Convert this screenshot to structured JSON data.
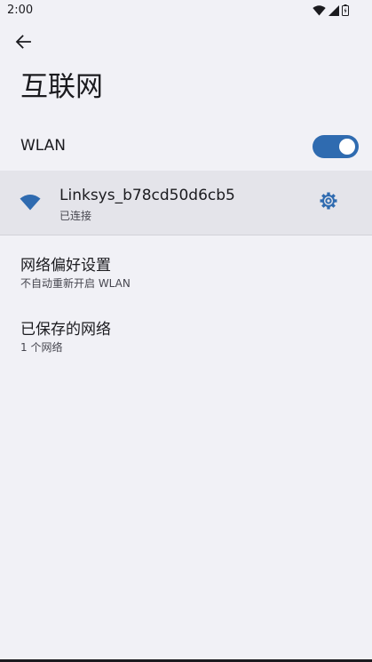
{
  "status_bar": {
    "time": "2:00",
    "icons": [
      "wifi-icon",
      "cellular-signal-icon",
      "battery-icon"
    ]
  },
  "header": {
    "title": "互联网"
  },
  "wlan": {
    "label": "WLAN",
    "enabled": true
  },
  "current_network": {
    "name": "Linksys_b78cd50d6cb5",
    "status": "已连接"
  },
  "preferences": [
    {
      "title": "网络偏好设置",
      "subtitle": "不自动重新开启 WLAN"
    },
    {
      "title": "已保存的网络",
      "subtitle": "1 个网络"
    }
  ],
  "colors": {
    "background": "#f1f1f6",
    "accent": "#2f6bb0",
    "selected_row": "#e4e4ea"
  }
}
